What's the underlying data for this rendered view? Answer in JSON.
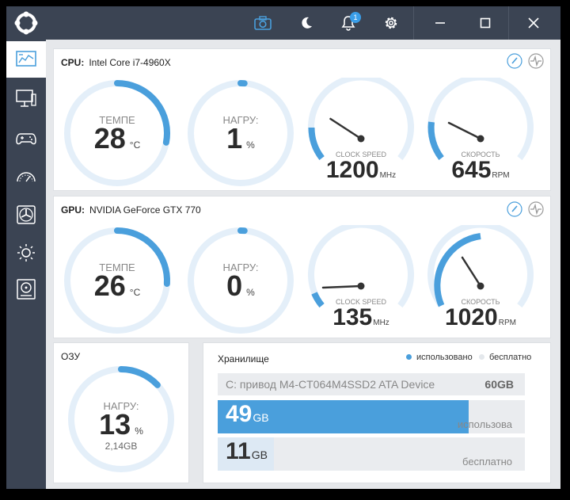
{
  "titlebar": {
    "notification_count": "1"
  },
  "cpu": {
    "label": "CPU:",
    "name": "Intel Core i7-4960X",
    "temp": {
      "label": "ТЕМПЕ",
      "value": "28",
      "unit": "°C",
      "level": 0.28
    },
    "load": {
      "label": "НАГРУ:",
      "value": "1",
      "unit": "%",
      "level": 0.01
    },
    "clock": {
      "label": "CLOCK SPEED",
      "value": "1200",
      "unit": "MHz"
    },
    "fan": {
      "label": "СКОРОСТЬ",
      "value": "645",
      "unit": "RPM"
    }
  },
  "gpu": {
    "label": "GPU:",
    "name": "NVIDIA GeForce GTX 770",
    "temp": {
      "label": "ТЕМПЕ",
      "value": "26",
      "unit": "°C",
      "level": 0.26
    },
    "load": {
      "label": "НАГРУ:",
      "value": "0",
      "unit": "%",
      "level": 0.0
    },
    "clock": {
      "label": "CLOCK SPEED",
      "value": "135",
      "unit": "MHz"
    },
    "fan": {
      "label": "СКОРОСТЬ",
      "value": "1020",
      "unit": "RPM"
    }
  },
  "ram": {
    "title": "ОЗУ",
    "load_label": "НАГРУ:",
    "value": "13",
    "unit": "%",
    "used": "2,14GB",
    "level": 0.13
  },
  "storage": {
    "title": "Хранилище",
    "legend_used": "использовано",
    "legend_free": "бесплатно",
    "drive_name": "C: привод M4-CT064M4SSD2 ATA Device",
    "drive_size": "60GB",
    "used_value": "49",
    "used_unit": "GB",
    "used_label": "использова",
    "used_fraction": 0.817,
    "free_value": "11",
    "free_unit": "GB",
    "free_label": "бесплатно",
    "free_fraction": 0.183
  },
  "colors": {
    "accent": "#4a9fdc",
    "track": "#e4eff9",
    "sidebar": "#3b4453",
    "free_bar": "#dde9f4"
  },
  "icons": {
    "logo": "app-logo-icon",
    "camera": "camera-icon",
    "theme": "moon-icon",
    "notifications": "bell-icon",
    "settings": "gear-icon",
    "minimize": "minimize-icon",
    "maximize": "maximize-icon",
    "close": "close-icon"
  }
}
